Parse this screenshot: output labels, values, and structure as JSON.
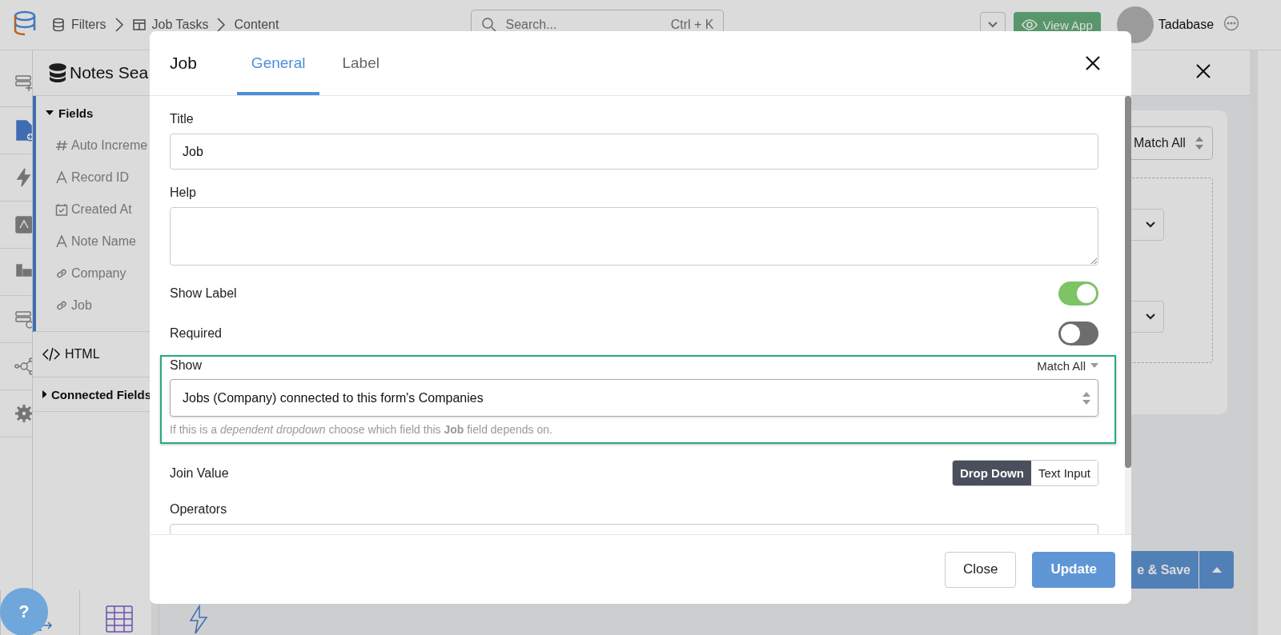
{
  "top_bar": {
    "breadcrumb": [
      {
        "label": "Filters",
        "kind": "database"
      },
      {
        "label": "Job Tasks",
        "kind": "table"
      },
      {
        "label": "Content",
        "kind": "none"
      }
    ],
    "search": {
      "placeholder": "Search...",
      "shortcut": "Ctrl + K"
    },
    "view_app": "View App",
    "user": "Tadabase"
  },
  "drawer": {
    "title": "Notes Sea",
    "sidebar": [
      {
        "label": "Fields",
        "kind": "group",
        "expanded": true,
        "items": [
          {
            "label": "Auto Increme",
            "kind": "number"
          },
          {
            "label": "Record ID",
            "kind": "text"
          },
          {
            "label": "Created At",
            "kind": "date"
          },
          {
            "label": "Note Name",
            "kind": "text"
          },
          {
            "label": "Company",
            "kind": "link"
          },
          {
            "label": "Job",
            "kind": "link"
          }
        ]
      },
      {
        "label": "HTML",
        "kind": "code"
      },
      {
        "label": "Connected Fields",
        "kind": "group",
        "expanded": false
      }
    ],
    "match_select": "Match All",
    "save_button": "e & Save"
  },
  "help_button": "?",
  "modal": {
    "title": "Job",
    "tabs": [
      {
        "label": "General",
        "selected": true
      },
      {
        "label": "Label",
        "selected": false
      }
    ],
    "rows": [
      {
        "kind": "text",
        "label": "Title",
        "value": "Job"
      },
      {
        "kind": "textarea",
        "label": "Help"
      },
      {
        "kind": "toggle",
        "label": "Show Label",
        "on": true
      },
      {
        "kind": "toggle",
        "label": "Required",
        "on": false
      },
      {
        "kind": "dependency",
        "label": "Show",
        "highlighted": true,
        "match": "Match All",
        "value": "Jobs (Company) connected to this form's Companies",
        "help": "If this is a *dependent dropdown* choose which field this **Job** field depends on."
      },
      {
        "kind": "segmented",
        "label": "Join Value",
        "options": [
          {
            "label": "Drop Down",
            "selected": true
          },
          {
            "label": "Text Input",
            "selected": false
          }
        ]
      },
      {
        "kind": "input",
        "label": "Operators"
      }
    ],
    "buttons": [
      {
        "label": "Close",
        "kind": "secondary"
      },
      {
        "label": "Update",
        "kind": "primary"
      }
    ]
  }
}
